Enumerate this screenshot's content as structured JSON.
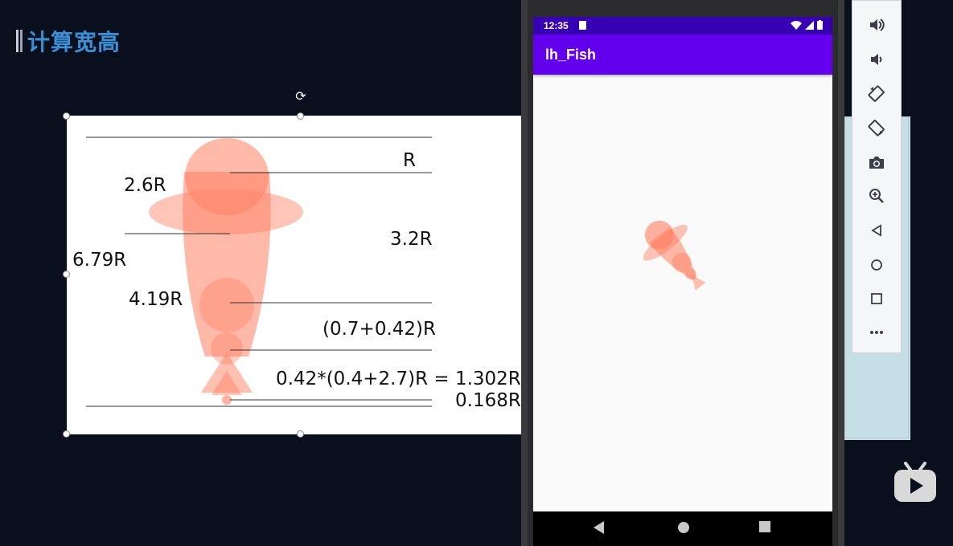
{
  "slide": {
    "title": "计算宽高"
  },
  "diagram": {
    "labels": {
      "r": "R",
      "r_2_6": "2.6R",
      "r_3_2": "3.2R",
      "r_6_79": "6.79R",
      "r_4_19": "4.19R",
      "r_sum": "(0.7+0.42)R",
      "r_product": "0.42*(0.4+2.7)R = 1.302R",
      "r_0_168": "0.168R"
    },
    "colors": {
      "fish": "#ff7f63",
      "fish_light": "#ffb3a1",
      "lines": "#333333"
    }
  },
  "emulator": {
    "status_bar": {
      "time": "12:35"
    },
    "app_bar": {
      "title": "lh_Fish"
    },
    "colors": {
      "status_bar": "#3700b3",
      "app_bar": "#6200ee",
      "screen_bg": "#fafafa",
      "fish": "#ff7f63"
    },
    "nav": {
      "back_icon": "back-triangle-icon",
      "home_icon": "home-circle-icon",
      "recents_icon": "recents-square-icon"
    }
  },
  "toolbar": {
    "tools": [
      "volume-up-icon",
      "volume-down-icon",
      "rotate-left-icon",
      "rotate-right-icon",
      "camera-icon",
      "zoom-icon",
      "back-icon",
      "home-icon",
      "overview-icon",
      "more-icon"
    ]
  }
}
